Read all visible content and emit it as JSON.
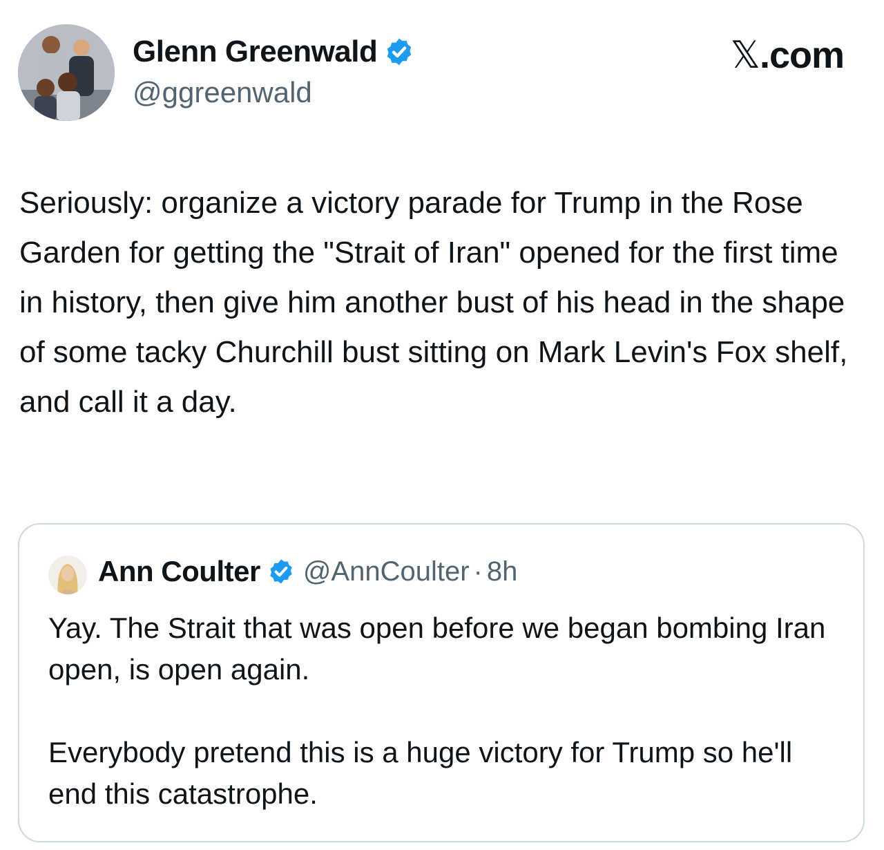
{
  "tweet": {
    "author_name": "Glenn Greenwald",
    "author_handle": "@ggreenwald",
    "text": "Seriously: organize a victory parade for Trump in the Rose Garden for getting the \"Strait of Iran\" opened for the first time in history, then give him another bust of his head in the shape of some tacky Churchill bust sitting on Mark Levin's Fox shelf, and call it a day."
  },
  "brand": {
    "x_glyph": "𝕏",
    "suffix": ".com"
  },
  "quote": {
    "author_name": "Ann Coulter",
    "author_handle": "@AnnCoulter",
    "separator": "·",
    "time": "8h",
    "text": "Yay. The Strait that was open before we began bombing Iran open, is open again.\n\nEverybody pretend this is a huge victory for Trump so he'll end this catastrophe."
  },
  "colors": {
    "verified_blue": "#1d9bf0",
    "text_primary": "#0f1419",
    "text_secondary": "#536471",
    "border": "#cfd9de"
  }
}
